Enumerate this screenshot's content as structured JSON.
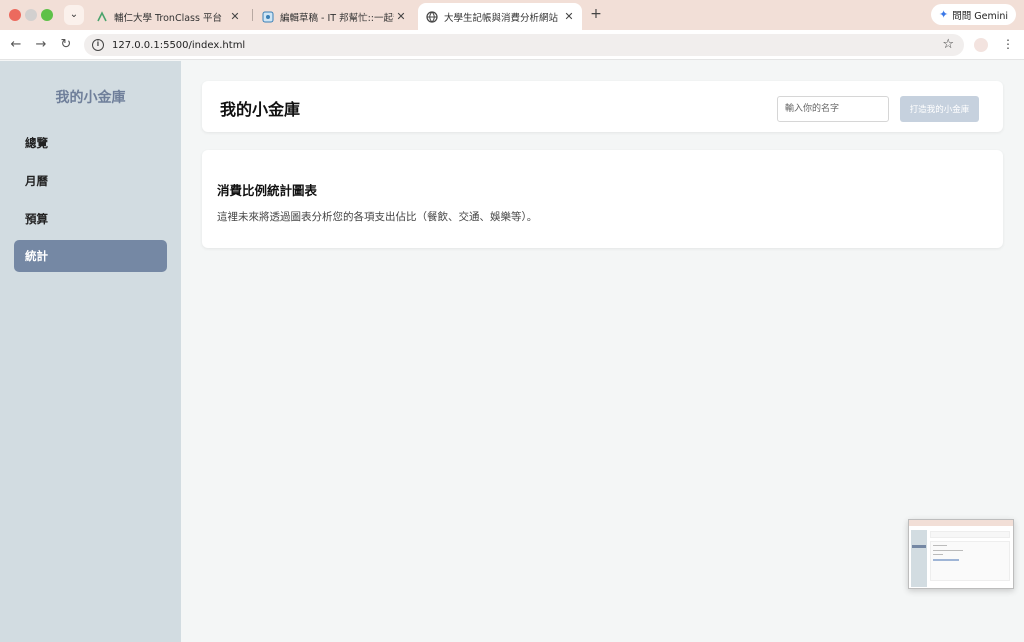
{
  "browser": {
    "tabs": [
      {
        "title": "輔仁大學 TronClass 平台",
        "active": false
      },
      {
        "title": "編輯草稿 - IT 邦幫忙::一起幫忙解決難題",
        "active": false
      },
      {
        "title": "大學生記帳與消費分析網站",
        "active": true
      }
    ],
    "gemini_label": "問問 Gemini",
    "url": "127.0.0.1:5500/index.html"
  },
  "sidebar": {
    "brand": "我的小金庫",
    "items": [
      {
        "label": "總覽",
        "active": false
      },
      {
        "label": "月曆",
        "active": false
      },
      {
        "label": "預算",
        "active": false
      },
      {
        "label": "統計",
        "active": true
      }
    ]
  },
  "header": {
    "title": "我的小金庫",
    "name_placeholder": "輸入你的名字",
    "create_button": "打造我的小金庫"
  },
  "stats_section": {
    "title": "消費比例統計圖表",
    "description": "這裡未來將透過圖表分析您的各項支出佔比（餐飲、交通、娛樂等）。"
  },
  "colors": {
    "sidebar_bg": "#d2dce1",
    "active_item": "#7588a4",
    "brand_text": "#6f7f9a",
    "tabbar": "#f2dfd7"
  }
}
